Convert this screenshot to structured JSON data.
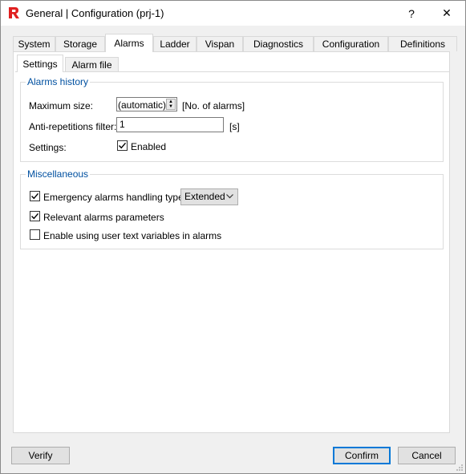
{
  "window": {
    "title": "General | Configuration (prj-1)",
    "help_glyph": "?",
    "close_glyph": "✕"
  },
  "tabs": [
    {
      "label": "System"
    },
    {
      "label": "Storage"
    },
    {
      "label": "Alarms",
      "active": true
    },
    {
      "label": "Ladder"
    },
    {
      "label": "Vispan"
    },
    {
      "label": "Diagnostics"
    },
    {
      "label": "Configuration"
    },
    {
      "label": "Definitions"
    }
  ],
  "subtabs": [
    {
      "label": "Settings",
      "active": true
    },
    {
      "label": "Alarm file"
    }
  ],
  "alarms_history": {
    "title": "Alarms history",
    "max_size_label": "Maximum size:",
    "max_size_value": "(automatic)",
    "max_size_unit": "[No. of alarms]",
    "anti_rep_label": "Anti-repetitions filter:",
    "anti_rep_value": "1",
    "anti_rep_unit": "[s]",
    "settings_label": "Settings:",
    "enabled_label": "Enabled",
    "enabled_checked": true
  },
  "misc": {
    "title": "Miscellaneous",
    "emergency_label": "Emergency alarms handling type:",
    "emergency_checked": true,
    "emergency_value": "Extended",
    "relevant_label": "Relevant alarms parameters",
    "relevant_checked": true,
    "user_text_label": "Enable using user text variables in alarms",
    "user_text_checked": false
  },
  "footer": {
    "verify_label": "Verify",
    "confirm_label": "Confirm",
    "cancel_label": "Cancel"
  },
  "colors": {
    "accent": "#0078d7",
    "group_title": "#0050a0",
    "app_icon_red": "#e02020"
  }
}
